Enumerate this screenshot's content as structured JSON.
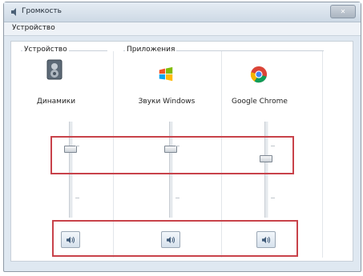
{
  "window": {
    "title": "Громкость",
    "close_label": "✕"
  },
  "menu": {
    "item": "Устройство"
  },
  "groups": {
    "device": "Устройство",
    "applications": "Приложения"
  },
  "channels": [
    {
      "name": "Динамики",
      "icon": "speaker-icon",
      "volume_fraction": 0.72,
      "muted": false
    },
    {
      "name": "Звуки Windows",
      "icon": "windows-logo-icon",
      "volume_fraction": 0.72,
      "muted": false
    },
    {
      "name": "Google Chrome",
      "icon": "chrome-icon",
      "volume_fraction": 0.62,
      "muted": false
    }
  ],
  "colors": {
    "highlight": "#c8424a",
    "window_background": "#dfe8f1"
  }
}
